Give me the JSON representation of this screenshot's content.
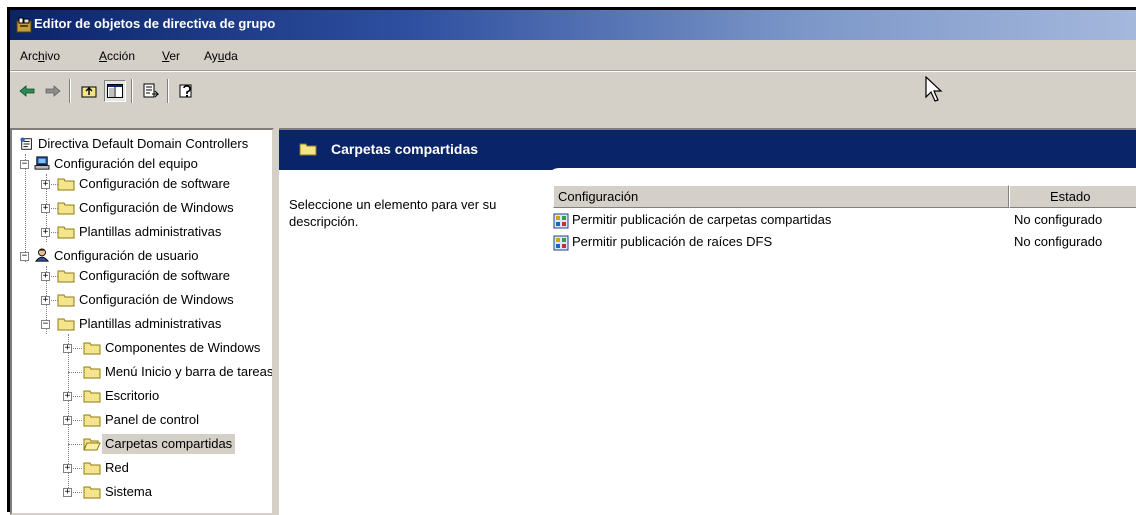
{
  "window": {
    "title": "Editor de objetos de directiva de grupo"
  },
  "menu": {
    "archivo_pre": "Arc",
    "archivo_u": "h",
    "archivo_post": "ivo",
    "accion_pre": "",
    "accion_u": "A",
    "accion_post": "cción",
    "ver_pre": "",
    "ver_u": "V",
    "ver_post": "er",
    "ayuda_pre": "Ay",
    "ayuda_u": "u",
    "ayuda_post": "da"
  },
  "tree": {
    "root": "Directiva Default Domain Controllers",
    "computer": "Configuración del equipo",
    "comp_software": "Configuración de software",
    "comp_windows": "Configuración de Windows",
    "comp_templates": "Plantillas administrativas",
    "user": "Configuración de usuario",
    "user_software": "Configuración de software",
    "user_windows": "Configuración de Windows",
    "user_templates": "Plantillas administrativas",
    "components": "Componentes de Windows",
    "startmenu": "Menú Inicio y barra de tareas",
    "desktop": "Escritorio",
    "control": "Panel de control",
    "shared": "Carpetas compartidas",
    "network": "Red",
    "system": "Sistema"
  },
  "main": {
    "header_title": "Carpetas compartidas",
    "description": "Seleccione un elemento para ver su descripción.",
    "col_config": "Configuración",
    "col_state": "Estado",
    "rows": [
      {
        "name": "Permitir publicación de carpetas compartidas",
        "state": "No configurado"
      },
      {
        "name": "Permitir publicación de raíces DFS",
        "state": "No configurado"
      }
    ]
  },
  "colors": {
    "title_blue": "#0a246a",
    "face": "#d4d0c8"
  }
}
